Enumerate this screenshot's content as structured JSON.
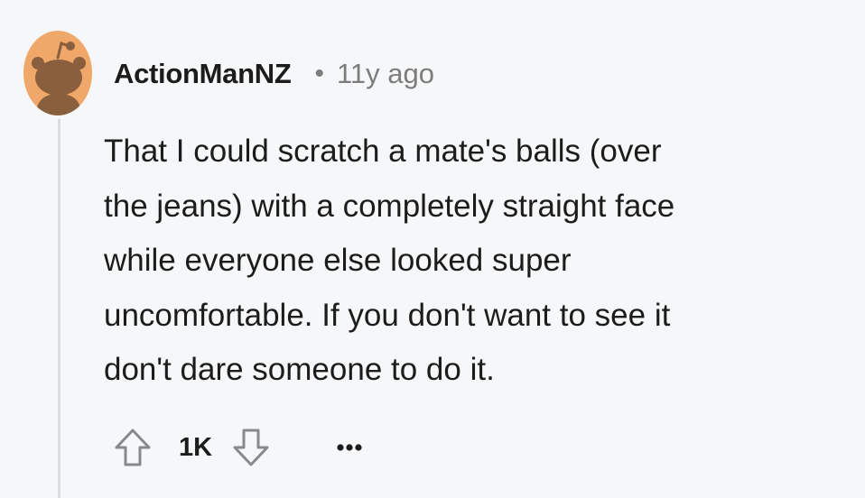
{
  "comment": {
    "author": "ActionManNZ",
    "separator": "•",
    "timestamp": "11y ago",
    "lines": [
      "That I could scratch a mate's balls (over",
      "the jeans) with a completely straight face",
      "while everyone else looked super",
      "uncomfortable. If you don't want to see it",
      "don't dare someone to do it."
    ]
  },
  "actions": {
    "score": "1K",
    "upvote_icon": "arrow-up-outline-icon",
    "downvote_icon": "arrow-down-outline-icon",
    "more_icon": "ellipsis-icon"
  },
  "colors": {
    "background": "#f6f7f8",
    "text": "#1c1c1c",
    "muted": "#7c7c7c",
    "thread_line": "#dadde0",
    "avatar_bg": "#f0a86a",
    "avatar_fg": "#8a5f3e"
  }
}
